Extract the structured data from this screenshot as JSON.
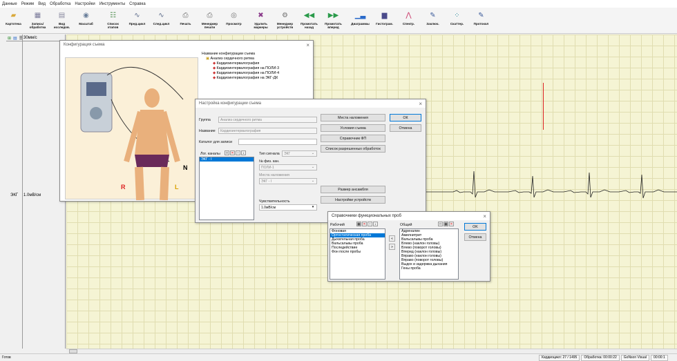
{
  "menu": [
    "Данные",
    "Режим",
    "Вид",
    "Обработка",
    "Настройки",
    "Инструменты",
    "Справка"
  ],
  "toolbar": [
    {
      "label": "Картотека",
      "icon": "folder-icon",
      "color": "#d9a93b"
    },
    {
      "label": "Запись/\nобработка",
      "icon": "record-icon",
      "color": "#7a7a9a"
    },
    {
      "label": "Вид\nисследов.",
      "icon": "view-icon",
      "color": "#8a8aa0"
    },
    {
      "label": "Масштаб",
      "icon": "zoom-icon",
      "color": "#6a7f9a"
    },
    {
      "label": "Список\nэтапов",
      "icon": "stages-icon",
      "color": "#4a8a4a"
    },
    {
      "label": "Пред.цикл",
      "icon": "prev-cycle-icon",
      "color": "#5a6a8a"
    },
    {
      "label": "След.цикл",
      "icon": "next-cycle-icon",
      "color": "#5a6a8a"
    },
    {
      "label": "Печать",
      "icon": "print-icon",
      "color": "#707070"
    },
    {
      "label": "Менеджер\nпечати",
      "icon": "print-manager-icon",
      "color": "#707070"
    },
    {
      "label": "Просмотр",
      "icon": "preview-icon",
      "color": "#707070"
    },
    {
      "label": "Удалить\nмаркеры",
      "icon": "delete-markers-icon",
      "color": "#8a3a8a"
    },
    {
      "label": "Менеджер\nустройств",
      "icon": "device-manager-icon",
      "color": "#707070"
    },
    {
      "label": "Промотать\nназад",
      "icon": "rewind-icon",
      "color": "#2a9a4a"
    },
    {
      "label": "Промотать\nвперед",
      "icon": "forward-icon",
      "color": "#2a9a4a"
    },
    {
      "label": "Диаграммы",
      "icon": "diagram-icon",
      "color": "#2a6aca"
    },
    {
      "label": "Гистограм.",
      "icon": "histogram-icon",
      "color": "#4a4a8a"
    },
    {
      "label": "Спектр.",
      "icon": "spectrum-icon",
      "color": "#ca3a6a"
    },
    {
      "label": "Заключ.",
      "icon": "conclusion-icon",
      "color": "#3a5a9a"
    },
    {
      "label": "Скаттер.",
      "icon": "scatter-icon",
      "color": "#2a8a9a"
    },
    {
      "label": "Протокол",
      "icon": "protocol-icon",
      "color": "#3a5a9a"
    }
  ],
  "leftpanel": {
    "speed": "30мм/с",
    "channel": "ЭКГ",
    "sens": "1.0мВ/см"
  },
  "config_window": {
    "title": "Конфигурация съема",
    "tree_header": "Название конфигурации съема",
    "tree_root": "Анализ сердечного ритма",
    "tree_items": [
      "Кардиоинтервалография",
      "Кардиоинтервалография на ПОЛИ-3",
      "Кардиоинтервалография на ПОЛИ-4",
      "Кардиоинтервалография на ЭКГ-ДК"
    ],
    "letters": {
      "r": "R",
      "l": "L",
      "n": "N"
    }
  },
  "settings_window": {
    "title": "Настройка конфигурации съема",
    "group_label": "Группа",
    "group_value": "Анализ сердечного ритма",
    "name_label": "Название",
    "name_value": "Кардиоинтервалография",
    "catalog_label": "Каталог для записи",
    "log_channels_label": "Лог. каналы",
    "log_channels": [
      "ЭКГ - I"
    ],
    "signal_type_label": "Тип сигнала",
    "signal_type_value": "ЭКГ",
    "phys_channel_label": "№ физ. кан.",
    "phys_channel_value": "ПОЛИ-1",
    "placement_label": "Места наложения",
    "placement_value": "ЭКГ - I",
    "sensitivity_label": "Чувствительность",
    "sensitivity_value": "1.0мВ/см",
    "buttons": [
      "Места наложения",
      "Условия съема",
      "Справочник ФП",
      "Список разрешенных обработок",
      "Размер ансамбля",
      "Настройки устройств"
    ],
    "ok": "ОК",
    "cancel": "Отмена"
  },
  "func_window": {
    "title": "Справочники функциональных проб",
    "working_label": "Рабочий",
    "common_label": "Общий",
    "working": [
      "Фоновая",
      "Ортостатическая проба",
      "Дыхательная проба",
      "Вальсальвы проба",
      "Последействие",
      "Фон после пробы"
    ],
    "working_selected": 1,
    "common": [
      "Адреналин",
      "Амилнитрит",
      "Вальсальвы проба",
      "Влево (наклон головы)",
      "Влево (поворот головы)",
      "Вперед (наклон головы)",
      "Вправо (наклон головы)",
      "Вправо (поворот головы)",
      "Выдох и задержка дыхания",
      "Гены проба"
    ],
    "ok": "OK",
    "cancel": "Отмена"
  },
  "status": {
    "left": "Готов",
    "cardio": "Кардиоцикл: 27 / 1495",
    "proc": "Обработка: 00:00:22",
    "theme": "GoNson Visual",
    "time": "00:00:1"
  }
}
